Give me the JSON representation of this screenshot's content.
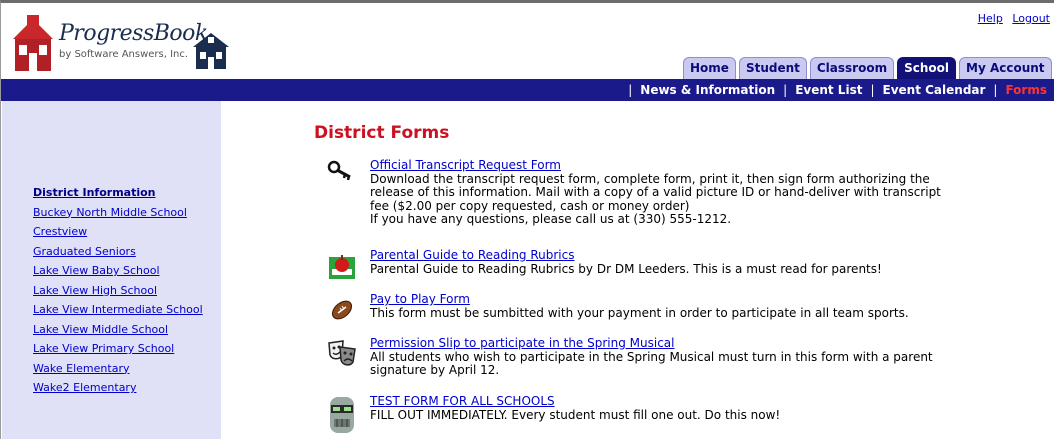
{
  "header": {
    "logo_title": "ProgressBook",
    "logo_subtitle": "by Software Answers, Inc.",
    "links": [
      "Help",
      "Logout"
    ]
  },
  "tabs": [
    {
      "label": "Home",
      "active": false
    },
    {
      "label": "Student",
      "active": false
    },
    {
      "label": "Classroom",
      "active": false
    },
    {
      "label": "School",
      "active": true
    },
    {
      "label": "My Account",
      "active": false
    }
  ],
  "subnav": [
    "News & Information",
    "Event List",
    "Event Calendar",
    "Forms"
  ],
  "sidebar": {
    "heading": "District Information",
    "items": [
      "Buckey North Middle School",
      "Crestview",
      "Graduated Seniors",
      "Lake View Baby School",
      "Lake View High School",
      "Lake View Intermediate School",
      "Lake View Middle School",
      "Lake View Primary School",
      "Wake Elementary",
      "Wake2 Elementary"
    ]
  },
  "main": {
    "title": "District Forms",
    "forms": [
      {
        "icon": "key-icon",
        "link": "Official Transcript Request Form",
        "desc": [
          "Download the transcript request form, complete form, print it, then sign form authorizing the",
          "release of this information. Mail with a copy of a valid picture ID or hand-deliver with transcript",
          "fee ($2.00 per copy requested, cash or money order)",
          "If you have any questions, please call us at (330) 555-1212."
        ]
      },
      {
        "icon": "apple-book-icon",
        "link": "Parental Guide to Reading Rubrics",
        "desc": [
          "Parental Guide to Reading Rubrics by Dr DM Leeders. This is a must read for parents!"
        ]
      },
      {
        "icon": "football-icon",
        "link": "Pay to Play Form",
        "desc": [
          "This form must be sumbitted with your payment in order to participate in all team sports."
        ]
      },
      {
        "icon": "theater-masks-icon",
        "link": "Permission Slip to participate in the Spring Musical",
        "desc": [
          "All students who wish to participate in the Spring Musical must turn in this form with a parent",
          "signature by April 12."
        ]
      },
      {
        "icon": "robot-icon",
        "link": "TEST FORM FOR ALL SCHOOLS",
        "desc": [
          "FILL OUT IMMEDIATELY. Every student must fill one out. Do this now!"
        ]
      }
    ]
  },
  "colors": {
    "navbar": "#1a1a8a",
    "tab_inactive": "#c9c9f2",
    "tab_active": "#111177",
    "sidebar_bg": "#e0e0f6",
    "title": "#cc1122",
    "current_nav": "#ff3333",
    "link": "#0000cc"
  }
}
